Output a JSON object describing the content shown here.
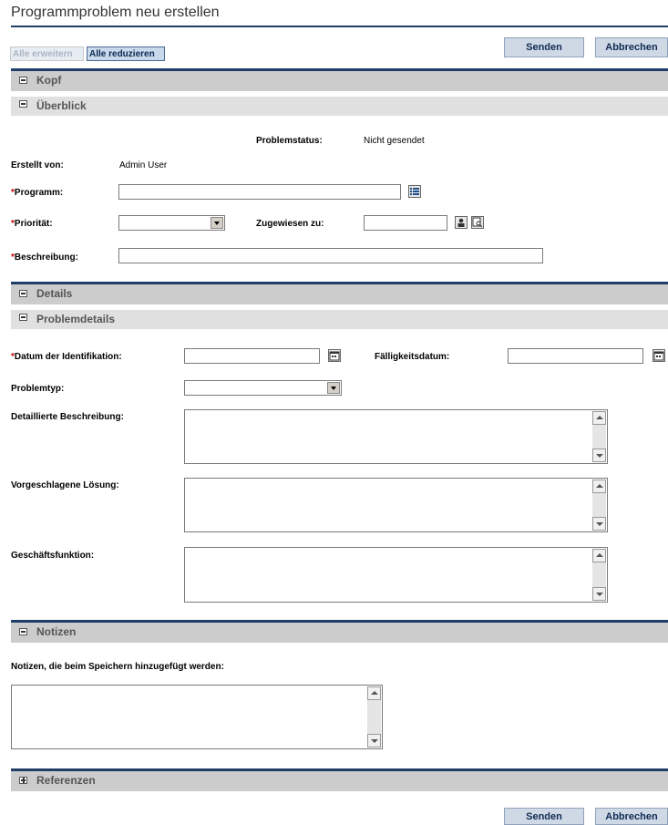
{
  "page": {
    "title": "Programmproblem neu erstellen"
  },
  "toolbar": {
    "expand_all": "Alle erweitern",
    "collapse_all": "Alle reduzieren",
    "submit": "Senden",
    "cancel": "Abbrechen"
  },
  "sections": {
    "kopf": "Kopf",
    "ueberblick": "Überblick",
    "details": "Details",
    "problemdetails": "Problemdetails",
    "notizen": "Notizen",
    "referenzen": "Referenzen"
  },
  "overview": {
    "status_label": "Problemstatus:",
    "status_value": "Nicht gesendet",
    "created_by_label": "Erstellt von:",
    "created_by_value": "Admin User",
    "program_label": "Programm:",
    "program_value": "",
    "priority_label": "Priorität:",
    "priority_value": "",
    "assigned_label": "Zugewiesen zu:",
    "assigned_value": "",
    "description_label": "Beschreibung:",
    "description_value": ""
  },
  "details": {
    "identification_date_label": "Datum der Identifikation:",
    "identification_date_value": "",
    "due_date_label": "Fälligkeitsdatum:",
    "due_date_value": "",
    "problem_type_label": "Problemtyp:",
    "problem_type_value": "",
    "detailed_description_label": "Detaillierte Beschreibung:",
    "proposed_solution_label": "Vorgeschlagene Lösung:",
    "business_function_label": "Geschäftsfunktion:"
  },
  "notes": {
    "label": "Notizen, die beim Speichern hinzugefügt werden:"
  },
  "required_marker": "*"
}
